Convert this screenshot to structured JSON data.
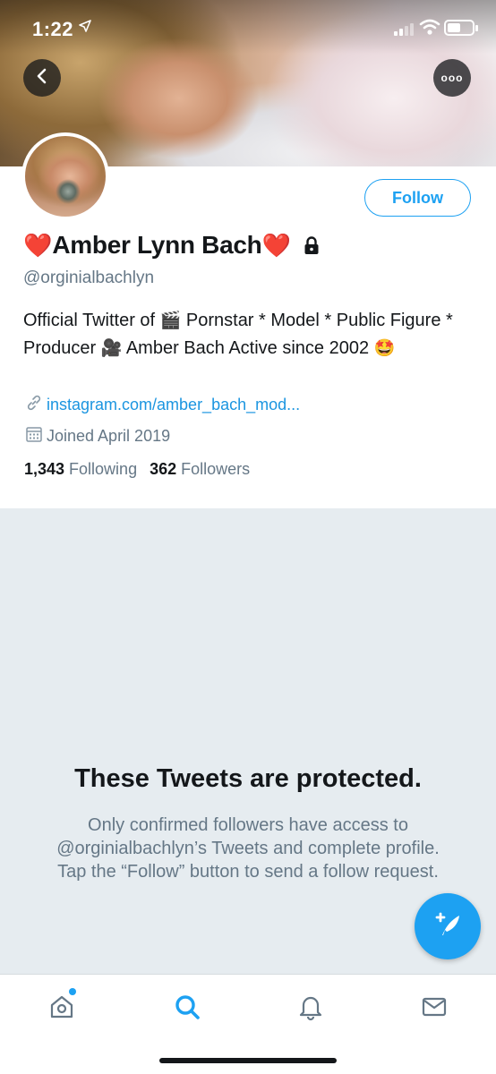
{
  "status_bar": {
    "time": "1:22",
    "location_icon": "location-arrow-icon",
    "signal_icon": "cellular-signal-icon",
    "wifi_icon": "wifi-icon",
    "battery_icon": "battery-icon"
  },
  "header": {
    "back_icon": "chevron-left-icon",
    "more_label": "ooo"
  },
  "profile": {
    "follow_label": "Follow",
    "name_prefix_emoji": "❤️",
    "name": "Amber Lynn Bach",
    "name_suffix_emoji": "❤️",
    "protected_icon": "lock-icon",
    "handle": "@orginialbachlyn",
    "bio": {
      "part1": "Official Twitter of ",
      "emoji1": "🎬",
      "part2": " Pornstar * Model * Public Figure * Producer ",
      "emoji2": "🎥",
      "part3": " Amber Bach Active since 2002 ",
      "emoji3": "🤩"
    },
    "link": "instagram.com/amber_bach_mod...",
    "joined": "Joined April 2019",
    "following_count": "1,343",
    "following_label": "Following",
    "followers_count": "362",
    "followers_label": "Followers"
  },
  "protected_notice": {
    "title": "These Tweets are protected.",
    "body": "Only confirmed followers have access to @orginialbachlyn’s Tweets and complete profile. Tap the “Follow” button to send a follow request."
  },
  "fab": {
    "icon": "compose-tweet-icon"
  },
  "bottom_nav": {
    "items": [
      "home-icon",
      "search-icon",
      "notifications-bell-icon",
      "messages-envelope-icon"
    ],
    "active": "search",
    "accent": "#1da1f2"
  },
  "colors": {
    "accent": "#1da1f2",
    "secondary_text": "#657786",
    "protected_bg": "#e6ecf0"
  }
}
